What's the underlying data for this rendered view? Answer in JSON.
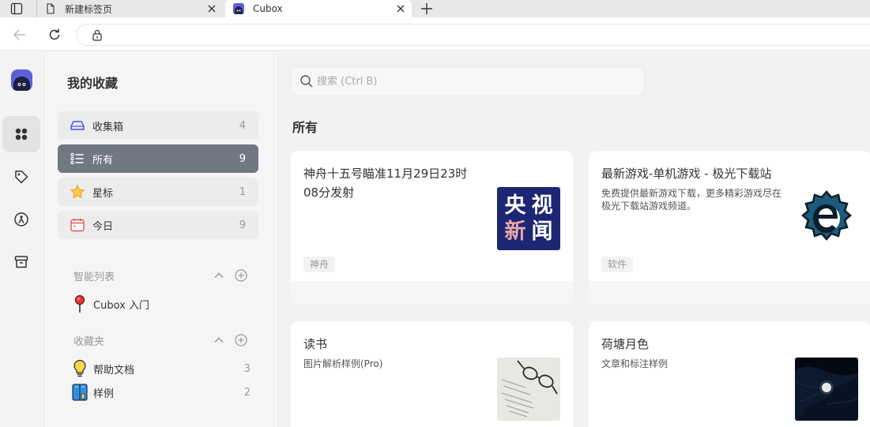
{
  "browser": {
    "tabs": [
      {
        "title": "新建标签页",
        "icon": "page-icon",
        "active": false
      },
      {
        "title": "Cubox",
        "icon": "cubox-favicon-icon",
        "active": true
      }
    ],
    "url": ""
  },
  "sidebar": {
    "title": "我的收藏",
    "items": [
      {
        "label": "收集箱",
        "count": "4",
        "icon": "inbox-icon"
      },
      {
        "label": "所有",
        "count": "9",
        "icon": "list-icon",
        "active": true
      },
      {
        "label": "星标",
        "count": "1",
        "icon": "star-icon"
      },
      {
        "label": "今日",
        "count": "9",
        "icon": "calendar-icon"
      }
    ],
    "smart_lists": {
      "label": "智能列表",
      "items": [
        {
          "label": "Cubox 入门",
          "icon": "pin-icon"
        }
      ]
    },
    "folders": {
      "label": "收藏夹",
      "items": [
        {
          "label": "帮助文档",
          "count": "3",
          "icon": "lightbulb-icon"
        },
        {
          "label": "样例",
          "count": "2",
          "icon": "book-icon"
        }
      ]
    }
  },
  "main": {
    "search_placeholder": "搜索 (Ctrl B)",
    "section_title": "所有",
    "cards": [
      {
        "title_line1": "神舟十五号瞄准11月29日23时",
        "title_line2": "08分发射",
        "desc_line1": "",
        "desc_line2": "",
        "tag": "神舟",
        "thumb": "cctv-news-logo",
        "logo_text": [
          "央",
          "视",
          "新",
          "闻"
        ]
      },
      {
        "title_line1": "最新游戏-单机游戏 - 极光下载站",
        "title_line2": "",
        "desc_line1": "免费提供最新游戏下载，更多精彩游戏尽在",
        "desc_line2": "极光下载站游戏频道。",
        "tag": "软件",
        "thumb": "cheat-engine-logo"
      },
      {
        "title_line1": "读书",
        "title_line2": "",
        "desc_line1": "图片解析样例(Pro)",
        "desc_line2": "",
        "tag": "",
        "thumb": "glasses-photo"
      },
      {
        "title_line1": "荷塘月色",
        "title_line2": "",
        "desc_line1": "文章和标注样例",
        "desc_line2": "",
        "tag": "",
        "thumb": "moon-night-photo"
      }
    ]
  },
  "colors": {
    "active_item": "#717783",
    "brand": "#5b62d6"
  }
}
